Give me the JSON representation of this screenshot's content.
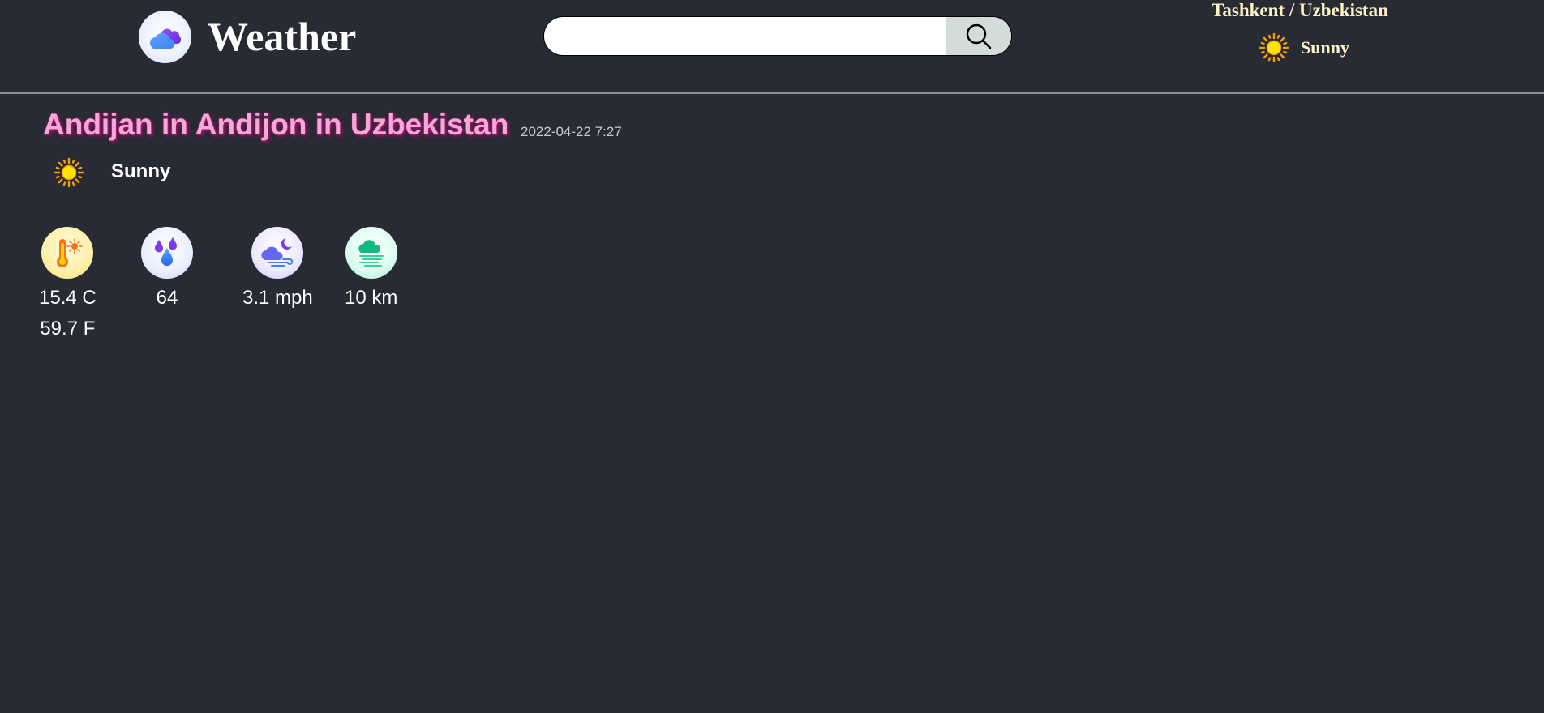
{
  "header": {
    "app_title": "Weather",
    "logo_icon": "cloud-icon",
    "search": {
      "value": "",
      "placeholder": "",
      "button_icon": "search-icon"
    },
    "current_location": {
      "name": "Tashkent / Uzbekistan",
      "condition": "Sunny",
      "condition_icon": "sun-icon"
    }
  },
  "main": {
    "title": "Andijan in Andijon in Uzbekistan",
    "local_time": "2022-04-22 7:27",
    "condition": "Sunny",
    "condition_icon": "sun-icon",
    "stats": [
      {
        "icon": "thermometer-icon",
        "value": "15.4 C",
        "value2": "59.7 F"
      },
      {
        "icon": "humidity-icon",
        "value": "64"
      },
      {
        "icon": "wind-icon",
        "value": "3.1 mph"
      },
      {
        "icon": "visibility-icon",
        "value": "10 km"
      }
    ]
  },
  "colors": {
    "background": "#282a34",
    "title_pink": "#f2a9d6",
    "header_text": "#fdf2c6",
    "sun_yellow": "#ffd200",
    "sun_orange": "#f59e0b"
  }
}
